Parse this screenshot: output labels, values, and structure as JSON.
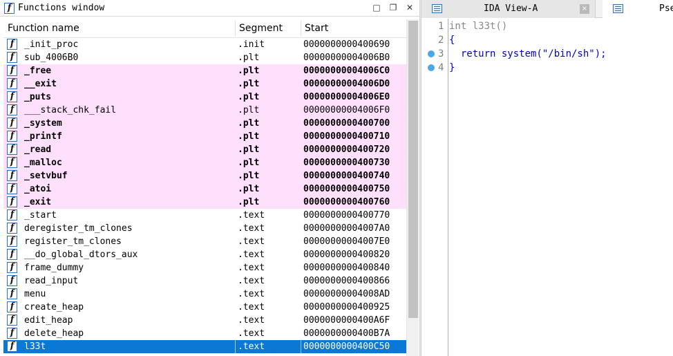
{
  "functions_window": {
    "title": "Functions window",
    "columns": {
      "name": "Function name",
      "segment": "Segment",
      "start": "Start"
    },
    "rows": [
      {
        "name": "_init_proc",
        "segment": ".init",
        "start": "0000000000400690",
        "style": "normal"
      },
      {
        "name": "sub_4006B0",
        "segment": ".plt",
        "start": "00000000004006B0",
        "style": "normal"
      },
      {
        "name": "_free",
        "segment": ".plt",
        "start": "00000000004006C0",
        "style": "pink-bold"
      },
      {
        "name": "__exit",
        "segment": ".plt",
        "start": "00000000004006D0",
        "style": "pink-bold"
      },
      {
        "name": "_puts",
        "segment": ".plt",
        "start": "00000000004006E0",
        "style": "pink-bold"
      },
      {
        "name": "___stack_chk_fail",
        "segment": ".plt",
        "start": "00000000004006F0",
        "style": "pink"
      },
      {
        "name": "_system",
        "segment": ".plt",
        "start": "0000000000400700",
        "style": "pink-bold"
      },
      {
        "name": "_printf",
        "segment": ".plt",
        "start": "0000000000400710",
        "style": "pink-bold"
      },
      {
        "name": "_read",
        "segment": ".plt",
        "start": "0000000000400720",
        "style": "pink-bold"
      },
      {
        "name": "_malloc",
        "segment": ".plt",
        "start": "0000000000400730",
        "style": "pink-bold"
      },
      {
        "name": "_setvbuf",
        "segment": ".plt",
        "start": "0000000000400740",
        "style": "pink-bold"
      },
      {
        "name": "_atoi",
        "segment": ".plt",
        "start": "0000000000400750",
        "style": "pink-bold"
      },
      {
        "name": "_exit",
        "segment": ".plt",
        "start": "0000000000400760",
        "style": "pink-bold"
      },
      {
        "name": "_start",
        "segment": ".text",
        "start": "0000000000400770",
        "style": "normal"
      },
      {
        "name": "deregister_tm_clones",
        "segment": ".text",
        "start": "00000000004007A0",
        "style": "normal"
      },
      {
        "name": "register_tm_clones",
        "segment": ".text",
        "start": "00000000004007E0",
        "style": "normal"
      },
      {
        "name": "__do_global_dtors_aux",
        "segment": ".text",
        "start": "0000000000400820",
        "style": "normal"
      },
      {
        "name": "frame_dummy",
        "segment": ".text",
        "start": "0000000000400840",
        "style": "normal"
      },
      {
        "name": "read_input",
        "segment": ".text",
        "start": "0000000000400866",
        "style": "normal"
      },
      {
        "name": "menu",
        "segment": ".text",
        "start": "00000000004008AD",
        "style": "normal"
      },
      {
        "name": "create_heap",
        "segment": ".text",
        "start": "0000000000400925",
        "style": "normal"
      },
      {
        "name": "edit_heap",
        "segment": ".text",
        "start": "0000000000400A6F",
        "style": "normal"
      },
      {
        "name": "delete_heap",
        "segment": ".text",
        "start": "0000000000400B7A",
        "style": "normal"
      },
      {
        "name": "l33t",
        "segment": ".text",
        "start": "0000000000400C50",
        "style": "selected"
      }
    ]
  },
  "tabs": [
    {
      "label": "IDA View-A",
      "close": "×"
    },
    {
      "label": "Pse"
    }
  ],
  "code": {
    "lines": [
      {
        "num": "1",
        "text": "int l33t()",
        "dim": true,
        "bp": false
      },
      {
        "num": "2",
        "text": "{",
        "dim": false,
        "bp": false
      },
      {
        "num": "3",
        "text": "  return system(\"/bin/sh\");",
        "dim": false,
        "bp": true
      },
      {
        "num": "4",
        "text": "}",
        "dim": false,
        "bp": true
      }
    ]
  },
  "colors": {
    "pink_row": "#ffe0fc",
    "selected_row": "#0a78d7",
    "breakpoint_dot": "#4aa8e8",
    "code_blue": "#0000c8"
  }
}
